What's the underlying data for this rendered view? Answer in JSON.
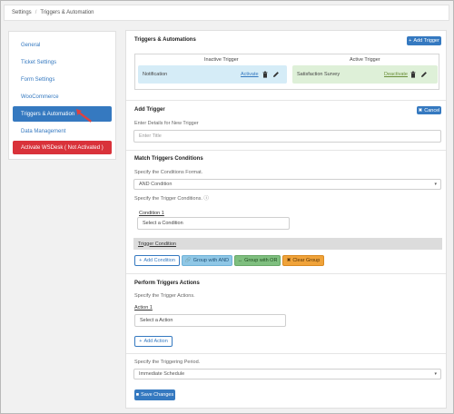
{
  "breadcrumb": {
    "root": "Settings",
    "separator": "/",
    "current": "Triggers & Automation"
  },
  "sidebar": {
    "items": [
      {
        "label": "General"
      },
      {
        "label": "Ticket Settings"
      },
      {
        "label": "Form Settings"
      },
      {
        "label": "WooCommerce"
      },
      {
        "label": "Triggers & Automation"
      },
      {
        "label": "Data Management"
      },
      {
        "label": "Activate WSDesk ( Not Activated )"
      }
    ],
    "active_index": 4
  },
  "triggers": {
    "title": "Triggers & Automations",
    "add_button": "Add Trigger",
    "inactive_header": "Inactive Trigger",
    "active_header": "Active Trigger",
    "inactive_item": {
      "name": "Notification",
      "action": "Activate"
    },
    "active_item": {
      "name": "Satisfaction Survey",
      "action": "Deactivate"
    }
  },
  "add_trigger": {
    "title": "Add Trigger",
    "cancel_button": "Cancel",
    "subtitle": "Enter Details for New Trigger",
    "title_placeholder": "Enter Title"
  },
  "conditions": {
    "title": "Match Triggers Conditions",
    "format_label": "Specify the Conditions Format.",
    "format_value": "AND Condition",
    "trigger_label": "Specify the Trigger Conditions. ⓘ",
    "condition_label": "Condition 1",
    "condition_placeholder": "Select a Condition",
    "section_label": "Trigger Condition",
    "buttons": {
      "add": "Add Condition",
      "group_and": "Group with AND",
      "group_or": "Group with OR",
      "clear": "Clear Group"
    }
  },
  "actions": {
    "title": "Perform Triggers Actions",
    "label": "Specify the Trigger Actions.",
    "action_label": "Action 1",
    "action_placeholder": "Select a Action",
    "add_button": "Add Action"
  },
  "period": {
    "label": "Specify the Triggering Period.",
    "value": "Immediate Schedule"
  },
  "save_button": "Save Changes",
  "colors": {
    "primary": "#3579c0",
    "danger": "#d9323a",
    "inactive_bg": "#d5ecf7",
    "active_bg": "#def0d8",
    "group_and": "#8fc7e6",
    "group_or": "#7fbf7f",
    "clear_group": "#f0a33a"
  }
}
